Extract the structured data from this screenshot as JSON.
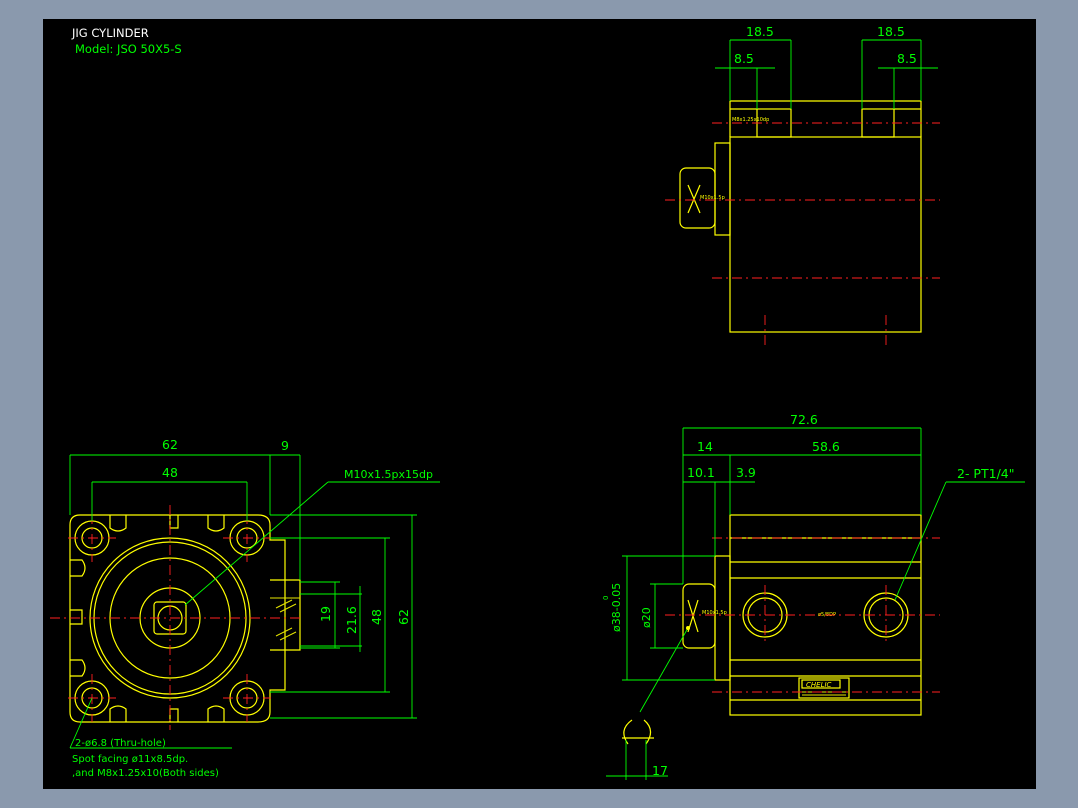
{
  "title": {
    "name": "JIG CYLINDER",
    "model": "Model: JSO 50X5-S"
  },
  "colors": {
    "background_outer": "#8a99ad",
    "canvas": "#000000",
    "outline": "#ffff00",
    "dimension": "#00ff00",
    "centerline": "#ff2020",
    "title": "#ffffff"
  },
  "top_view": {
    "dim_left_outer": "18.5",
    "dim_left_inner": "8.5",
    "dim_right_outer": "18.5",
    "dim_right_inner": "8.5",
    "port_label_small": "M8x1.25x10dp",
    "rod_label_small": "M10x1.5p"
  },
  "front_view": {
    "dim_width": "62",
    "dim_hole_pitch": "48",
    "dim_offset": "9",
    "dim_rod_flat": "19",
    "dim_rod_flat_outer": "21.6",
    "dim_hole_pitch_vertical": "48",
    "dim_height": "62",
    "callout_thread": "M10x1.5px15dp",
    "note_line1": "2-ø6.8 (Thru-hole)",
    "note_line2": "Spot facing  ø11x8.5dp.",
    "note_line3": ",and  M8x1.25x10(Both sides)"
  },
  "side_view": {
    "dim_total": "72.6",
    "dim_rod_part": "14",
    "dim_body": "58.6",
    "dim_a": "10.1",
    "dim_b": "3.9",
    "dim_port": "2- PT1/4\"",
    "dim_bore_dia": "ø38-0.05",
    "dim_bore_tol": "0",
    "dim_rod_dia": "ø20",
    "dim_tip": "17",
    "logo_text": "CHELIC",
    "rod_label_small": "M10x1.5p",
    "port_label_small": "ø5/8DP"
  }
}
